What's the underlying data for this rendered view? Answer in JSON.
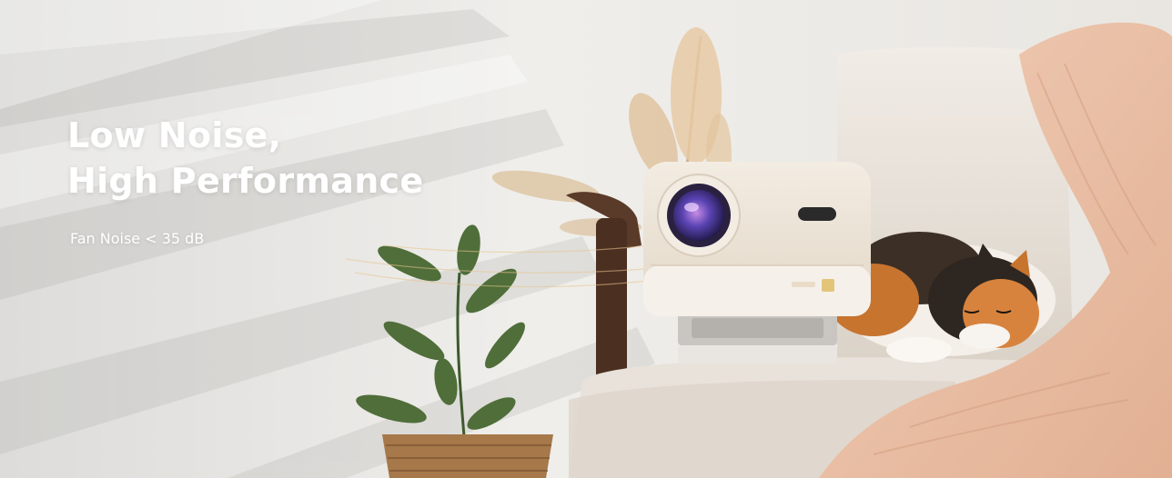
{
  "banner": {
    "headline_line1": "Low Noise,",
    "headline_line2": "High Performance",
    "subline": "Fan Noise < 35 dB"
  },
  "colors": {
    "wall": "#ece9e4",
    "sofa": "#e4ddd2",
    "blanket": "#e8c2a8",
    "projector_body": "#ece3d6",
    "lens": "#4b3b8f",
    "plant": "#4f6e3a",
    "basket": "#a6784a",
    "text": "#ffffff"
  },
  "icons": [
    "projector-lens-icon",
    "sensor-icon",
    "4k-badge-icon"
  ]
}
